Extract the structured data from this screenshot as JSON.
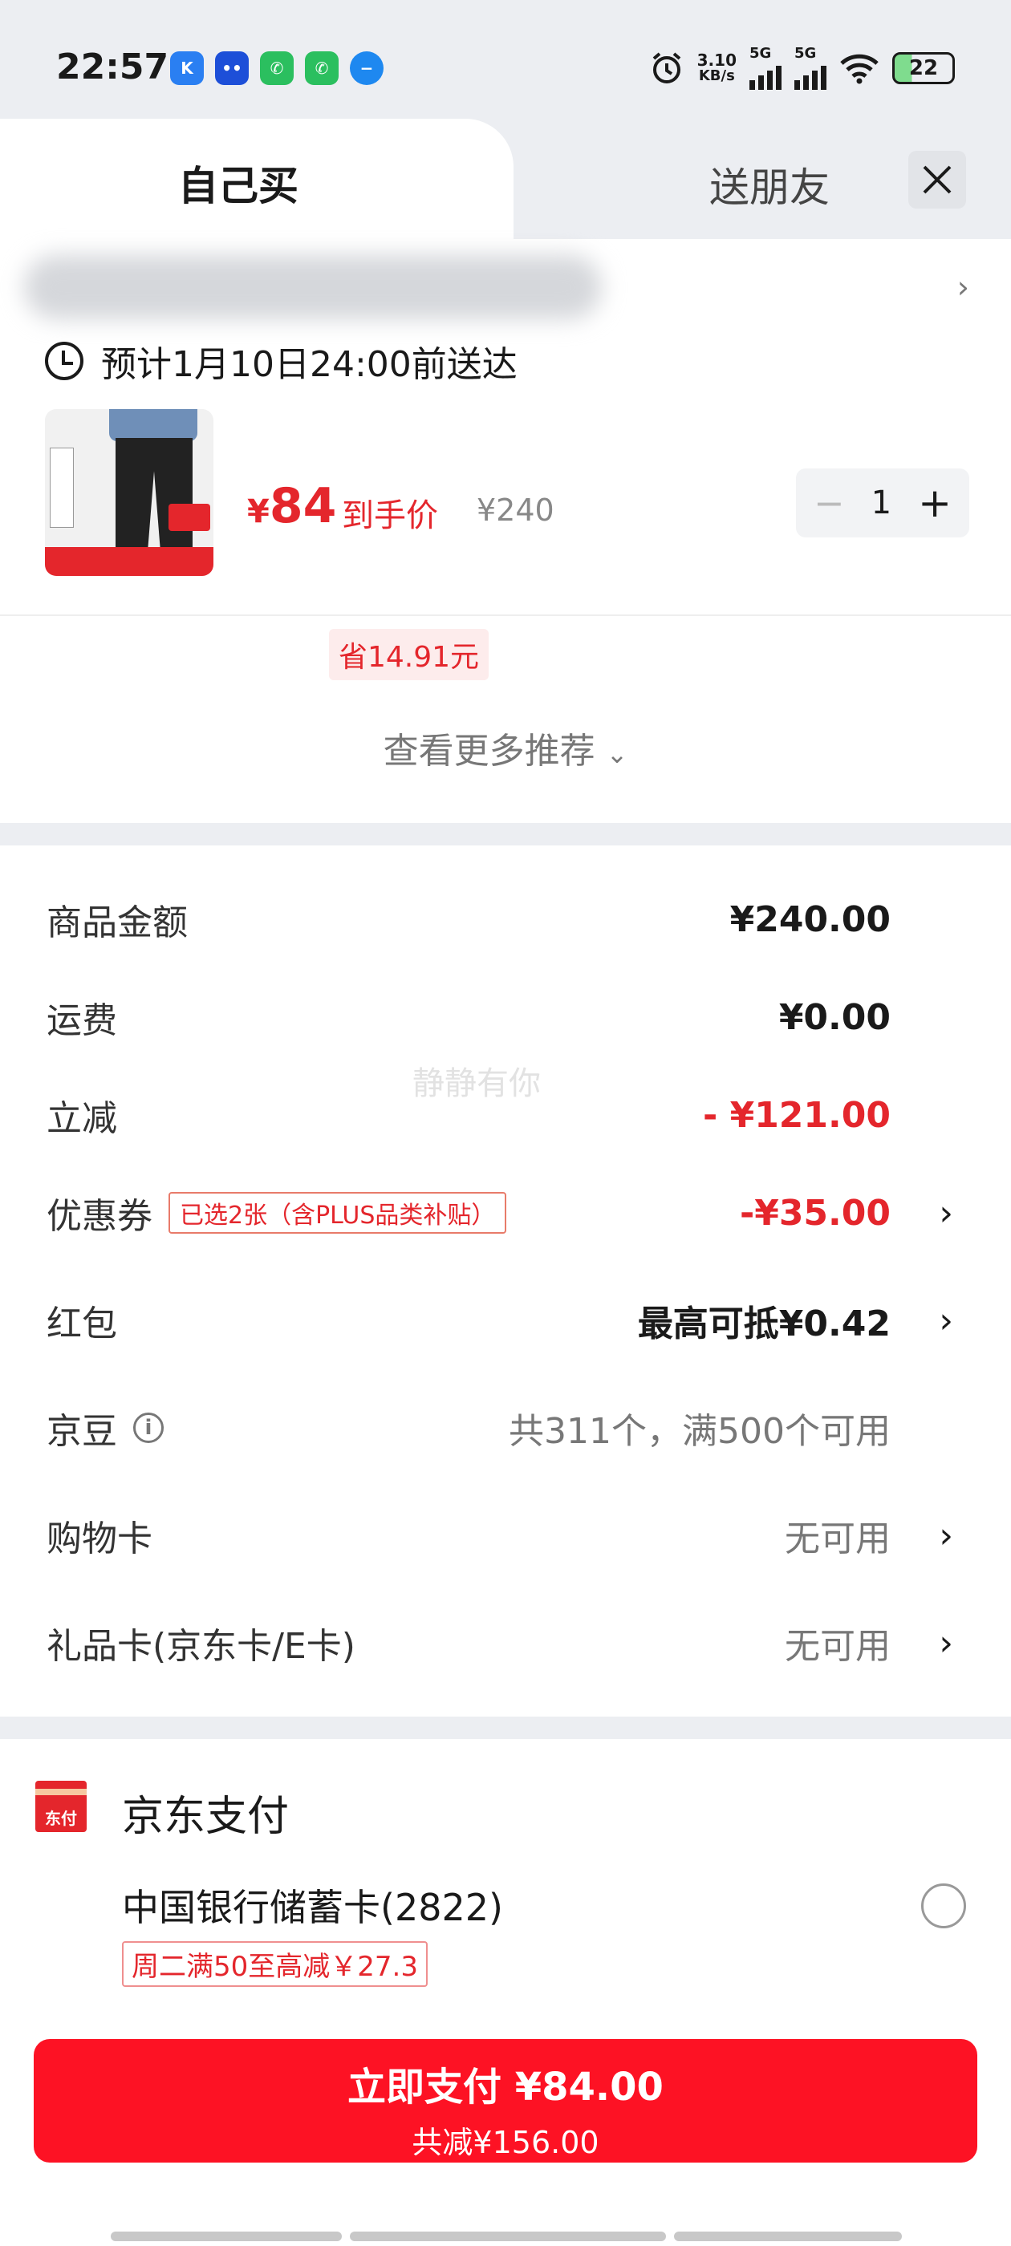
{
  "status_bar": {
    "time": "22:57",
    "net_speed": "3.10",
    "net_unit": "KB/s",
    "sim1": "5G",
    "sim2": "5G",
    "battery": "22"
  },
  "tabs": {
    "self": "自己买",
    "friend": "送朋友"
  },
  "delivery": {
    "eta": "预计1月10日24:00前送达"
  },
  "product": {
    "price_symbol": "¥",
    "price": "84",
    "price_label": "到手价",
    "original_price": "¥240",
    "quantity": "1",
    "savings": "省14.91元"
  },
  "more_recommendations": "查看更多推荐",
  "summary": {
    "goods_label": "商品金额",
    "goods_value": "¥240.00",
    "shipping_label": "运费",
    "shipping_value": "¥0.00",
    "discount_label": "立减",
    "discount_value": "- ¥121.00",
    "coupon_label": "优惠券",
    "coupon_tag": "已选2张（含PLUS品类补贴）",
    "coupon_value": "-¥35.00",
    "redpacket_label": "红包",
    "redpacket_value": "最高可抵¥0.42",
    "beans_label": "京豆",
    "beans_value": "共311个，满500个可用",
    "shopping_card_label": "购物卡",
    "shopping_card_value": "无可用",
    "gift_card_label": "礼品卡(京东卡/E卡)",
    "gift_card_value": "无可用",
    "watermark": "静静有你"
  },
  "payment": {
    "icon_text": "东付",
    "title": "京东支付",
    "bank": "中国银行储蓄卡(2822)",
    "promo": "周二满50至高减￥27.3"
  },
  "pay_button": {
    "main": "立即支付 ¥84.00",
    "sub": "共减¥156.00"
  },
  "colors": {
    "accent": "#e4262c",
    "button": "#fd1224"
  }
}
